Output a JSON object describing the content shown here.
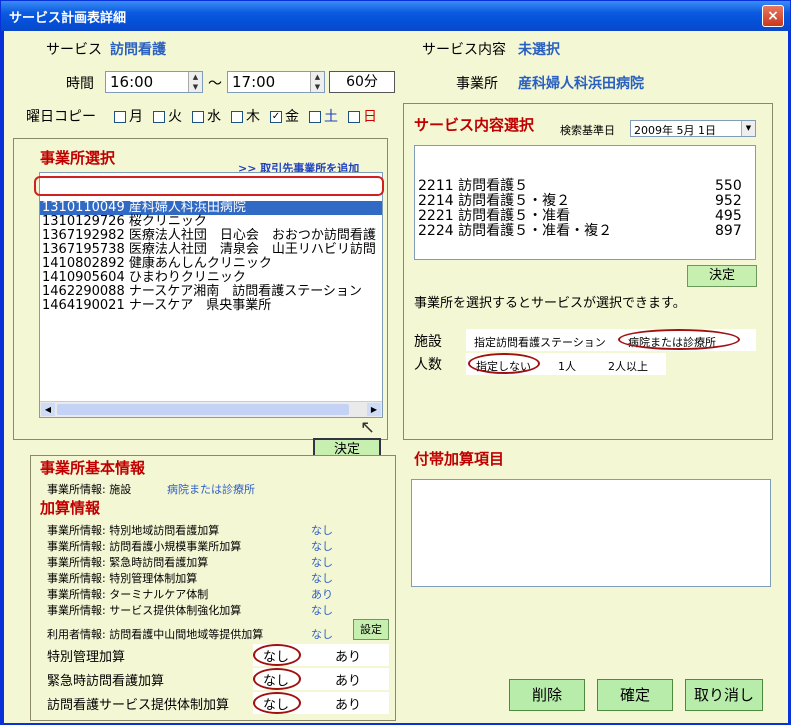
{
  "window": {
    "title": "サービス計画表詳細",
    "close": "×"
  },
  "top": {
    "service_label": "サービス",
    "service_value": "訪問看護",
    "content_label": "サービス内容",
    "content_value": "未選択",
    "time_label": "時間",
    "start_time": "16:00",
    "tilde": "～",
    "end_time": "17:00",
    "duration": "60分",
    "office_label": "事業所",
    "office_value": "産科婦人科浜田病院"
  },
  "days": {
    "label": "曜日コピー",
    "items": [
      {
        "label": "月",
        "checked": false,
        "color": "#000000"
      },
      {
        "label": "火",
        "checked": false,
        "color": "#000000"
      },
      {
        "label": "水",
        "checked": false,
        "color": "#000000"
      },
      {
        "label": "木",
        "checked": false,
        "color": "#000000"
      },
      {
        "label": "金",
        "checked": true,
        "color": "#000000"
      },
      {
        "label": "土",
        "checked": false,
        "color": "#2040c0"
      },
      {
        "label": "日",
        "checked": false,
        "color": "#d00000"
      }
    ]
  },
  "office_select": {
    "title": "事業所選択",
    "add_link": ">> 取引先事業所を追加",
    "rows": [
      "1310110049 産科婦人科浜田病院",
      "1310129726 桜クリニック",
      "1367192982 医療法人社団　日心会　おおつか訪問看護",
      "1367195738 医療法人社団　清泉会　山王リハビリ訪問",
      "1410802892 健康あんしんクリニック",
      "1410905604 ひまわりクリニック",
      "1462290088 ナースケア湘南　訪問看護ステーション",
      "1464190021 ナースケア　県央事業所"
    ],
    "selected_index": 0,
    "decide": "決定"
  },
  "service_select": {
    "title": "サービス内容選択",
    "base_date_label": "検索基準日",
    "base_date": "2009年  5月 1日",
    "rows": [
      {
        "code": "2211",
        "name": "訪問看護５",
        "units": "550"
      },
      {
        "code": "2214",
        "name": "訪問看護５・複２",
        "units": "952"
      },
      {
        "code": "2221",
        "name": "訪問看護５・准看",
        "units": "495"
      },
      {
        "code": "2224",
        "name": "訪問看護５・准看・複２",
        "units": "897"
      }
    ],
    "decide": "決定",
    "note": "事業所を選択するとサービスが選択できます。",
    "facility_label": "施設",
    "facility_opt1": "指定訪問看護ステーション",
    "facility_opt2": "病院または診療所",
    "people_label": "人数",
    "people_opt1": "指定しない",
    "people_opt2": "1人",
    "people_opt3": "2人以上"
  },
  "basic_info": {
    "title": "事業所基本情報",
    "facility_key": "事業所情報: 施設",
    "facility_val": "病院または診療所",
    "add_title": "加算情報",
    "items": [
      {
        "k": "事業所情報: 特別地域訪問看護加算",
        "v": "なし"
      },
      {
        "k": "事業所情報: 訪問看護小規模事業所加算",
        "v": "なし"
      },
      {
        "k": "事業所情報: 緊急時訪問看護加算",
        "v": "なし"
      },
      {
        "k": "事業所情報: 特別管理体制加算",
        "v": "なし"
      },
      {
        "k": "事業所情報: ターミナルケア体制",
        "v": "あり"
      },
      {
        "k": "事業所情報: サービス提供体制強化加算",
        "v": "なし"
      }
    ],
    "user_key": "利用者情報: 訪問看護中山間地域等提供加算",
    "user_val": "なし",
    "set_btn": "設定",
    "options": [
      {
        "label": "特別管理加算",
        "a": "なし",
        "b": "あり"
      },
      {
        "label": "緊急時訪問看護加算",
        "a": "なし",
        "b": "あり"
      },
      {
        "label": "訪問看護サービス提供体制加算",
        "a": "なし",
        "b": "あり"
      }
    ]
  },
  "extra": {
    "title": "付帯加算項目"
  },
  "buttons": {
    "delete": "削除",
    "confirm": "確定",
    "cancel": "取り消し"
  }
}
